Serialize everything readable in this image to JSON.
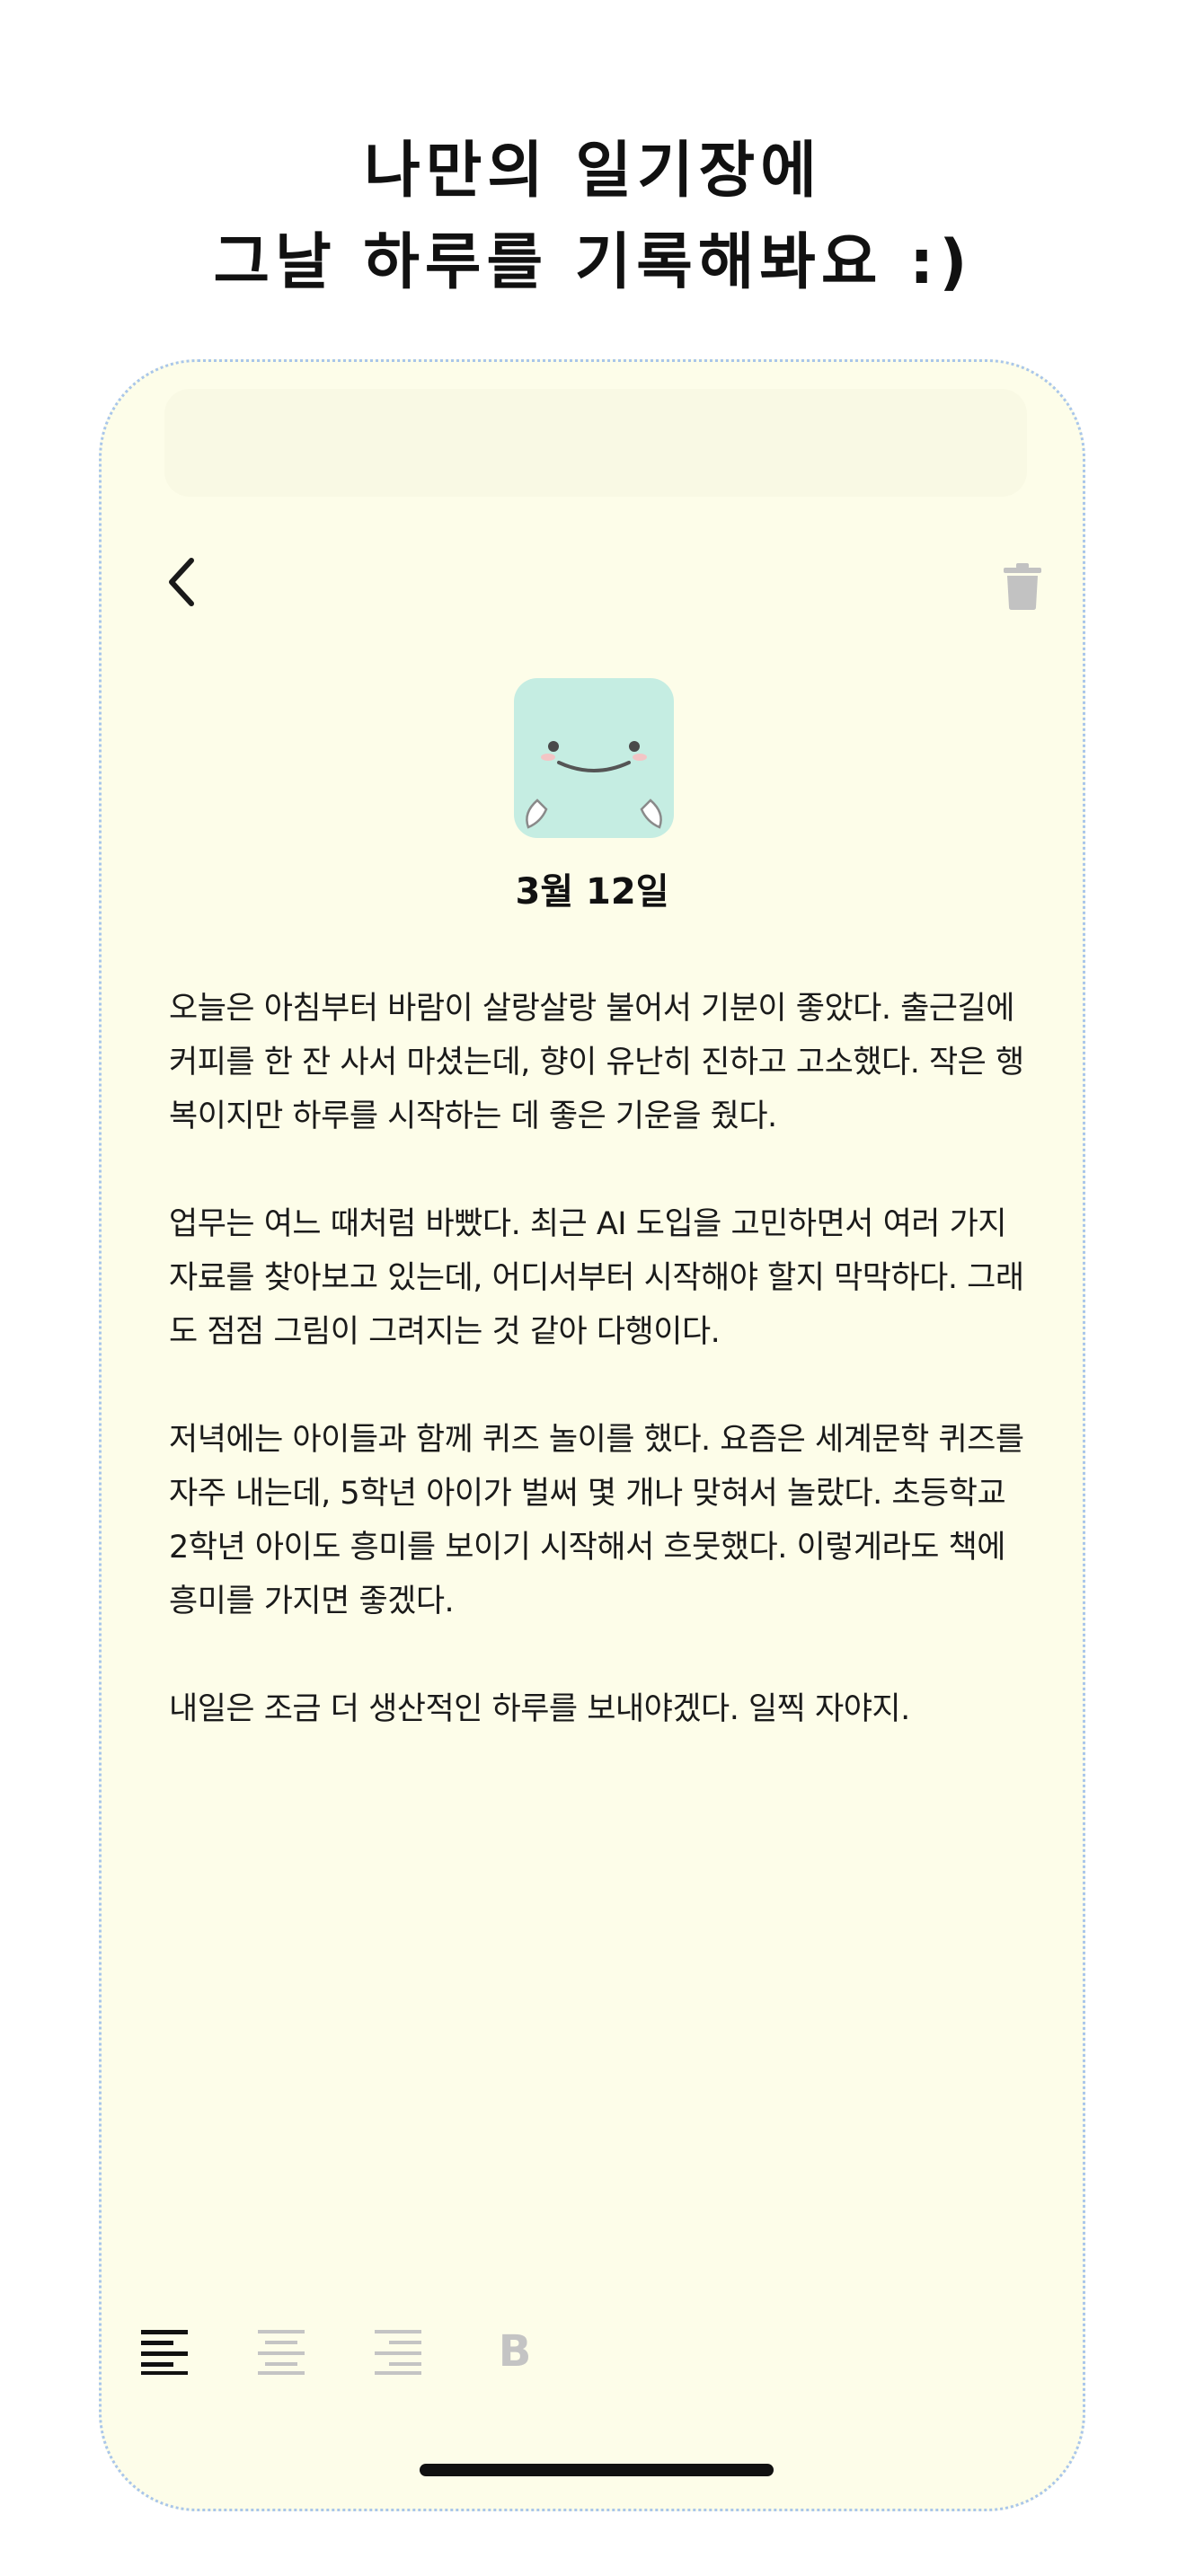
{
  "headline": {
    "line1": "나만의 일기장에",
    "line2": "그날 하루를 기록해봐요 :)"
  },
  "toolbar": {
    "back_icon": "chevron-left-icon",
    "delete_icon": "trash-icon"
  },
  "entry": {
    "mood_icon": "smiling-face-mint-icon",
    "date": "3월 12일",
    "paragraphs": [
      "오늘은 아침부터 바람이 살랑살랑 불어서 기분이 좋았다. 출근길에 커피를 한 잔 사서 마셨는데, 향이 유난히 진하고 고소했다. 작은 행복이지만 하루를 시작하는 데 좋은 기운을 줬다.",
      "업무는 여느 때처럼 바빴다. 최근 AI 도입을 고민하면서 여러 가지 자료를 찾아보고 있는데, 어디서부터 시작해야 할지 막막하다. 그래도 점점 그림이 그려지는 것 같아 다행이다.",
      "저녁에는 아이들과 함께 퀴즈 놀이를 했다. 요즘은 세계문학 퀴즈를 자주 내는데, 5학년 아이가 벌써 몇 개나 맞혀서 놀랐다. 초등학교 2학년 아이도 흥미를 보이기 시작해서 흐뭇했다. 이렇게라도 책에 흥미를 가지면 좋겠다.",
      "내일은 조금 더 생산적인 하루를 보내야겠다. 일찍 자야지."
    ]
  },
  "format_bar": {
    "align_left_icon": "align-left-icon",
    "align_center_icon": "align-center-icon",
    "align_right_icon": "align-right-icon",
    "bold_label": "B",
    "active": "align-left"
  },
  "colors": {
    "page_background": "#ffffff",
    "paper_background": "#fdfde9",
    "phone_border": "#a9c6ea",
    "mood_icon_bg": "#c5ede2",
    "active_tool": "#111111",
    "inactive_tool": "#c4c4c4"
  }
}
